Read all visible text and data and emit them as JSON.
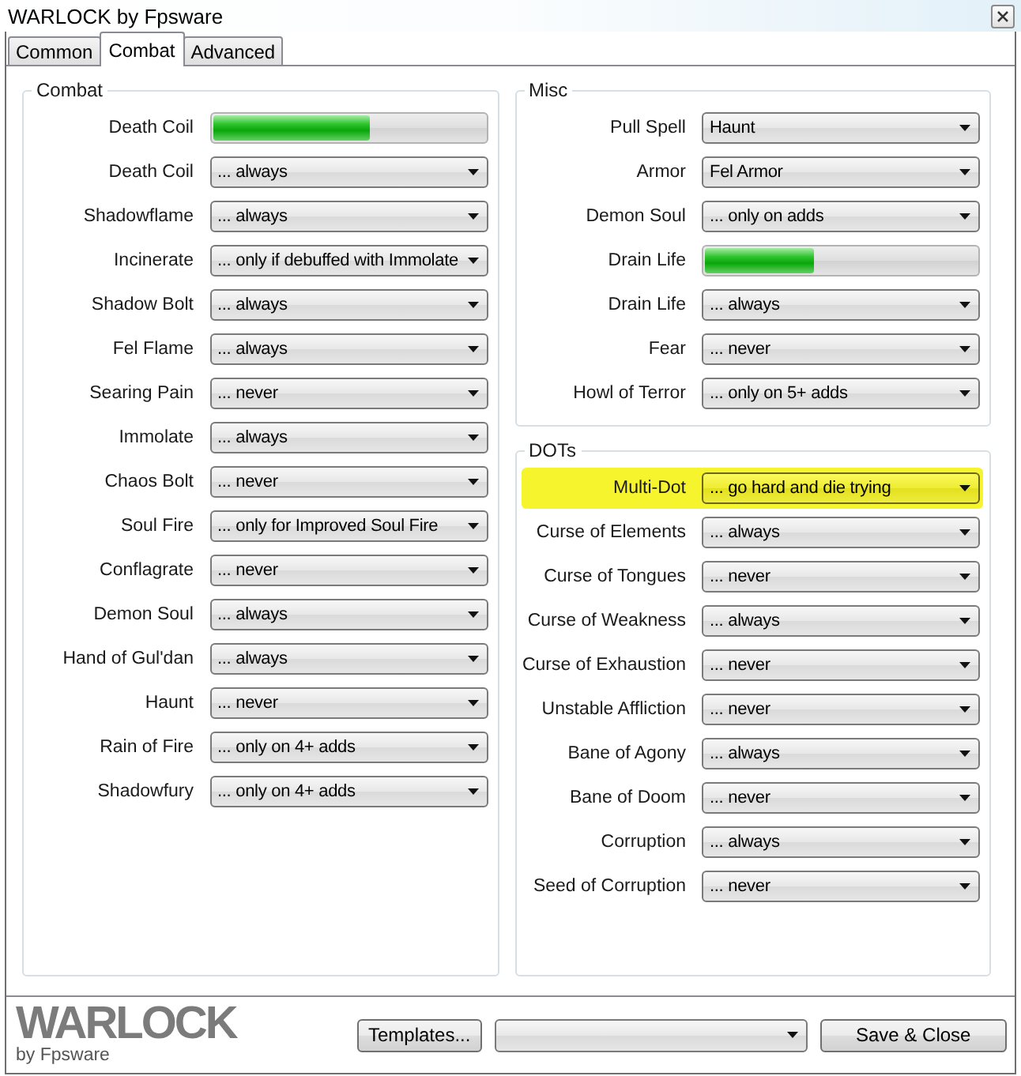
{
  "window": {
    "title": "WARLOCK by Fpsware"
  },
  "tabs": [
    {
      "label": "Common",
      "selected": false
    },
    {
      "label": "Combat",
      "selected": true
    },
    {
      "label": "Advanced",
      "selected": false
    }
  ],
  "columns": [
    {
      "groups": [
        {
          "title": "Combat",
          "rows": [
            {
              "label": "Death Coil",
              "kind": "slider",
              "level": 0.58,
              "highlighted": false
            },
            {
              "label": "Death Coil",
              "kind": "dropdown",
              "value": "... always",
              "highlighted": false
            },
            {
              "label": "Shadowflame",
              "kind": "dropdown",
              "value": "... always",
              "highlighted": false
            },
            {
              "label": "Incinerate",
              "kind": "dropdown",
              "value": "... only if debuffed with Immolate",
              "highlighted": false
            },
            {
              "label": "Shadow Bolt",
              "kind": "dropdown",
              "value": "... always",
              "highlighted": false
            },
            {
              "label": "Fel Flame",
              "kind": "dropdown",
              "value": "... always",
              "highlighted": false
            },
            {
              "label": "Searing Pain",
              "kind": "dropdown",
              "value": "... never",
              "highlighted": false
            },
            {
              "label": "Immolate",
              "kind": "dropdown",
              "value": "... always",
              "highlighted": false
            },
            {
              "label": "Chaos Bolt",
              "kind": "dropdown",
              "value": "... never",
              "highlighted": false
            },
            {
              "label": "Soul Fire",
              "kind": "dropdown",
              "value": "... only for Improved Soul Fire",
              "highlighted": false
            },
            {
              "label": "Conflagrate",
              "kind": "dropdown",
              "value": "... never",
              "highlighted": false
            },
            {
              "label": "Demon Soul",
              "kind": "dropdown",
              "value": "... always",
              "highlighted": false
            },
            {
              "label": "Hand of Gul'dan",
              "kind": "dropdown",
              "value": "... always",
              "highlighted": false
            },
            {
              "label": "Haunt",
              "kind": "dropdown",
              "value": "... never",
              "highlighted": false
            },
            {
              "label": "Rain of Fire",
              "kind": "dropdown",
              "value": "... only on 4+ adds",
              "highlighted": false
            },
            {
              "label": "Shadowfury",
              "kind": "dropdown",
              "value": "... only on 4+ adds",
              "highlighted": false
            }
          ]
        }
      ]
    },
    {
      "groups": [
        {
          "title": "Misc",
          "rows": [
            {
              "label": "Pull Spell",
              "kind": "dropdown",
              "value": "Haunt",
              "highlighted": false
            },
            {
              "label": "Armor",
              "kind": "dropdown",
              "value": "Fel Armor",
              "highlighted": false
            },
            {
              "label": "Demon Soul",
              "kind": "dropdown",
              "value": "... only on adds",
              "highlighted": false
            },
            {
              "label": "Drain Life",
              "kind": "slider",
              "level": 0.4,
              "highlighted": false
            },
            {
              "label": "Drain Life",
              "kind": "dropdown",
              "value": "... always",
              "highlighted": false
            },
            {
              "label": "Fear",
              "kind": "dropdown",
              "value": "... never",
              "highlighted": false
            },
            {
              "label": "Howl of Terror",
              "kind": "dropdown",
              "value": "... only on 5+ adds",
              "highlighted": false
            }
          ]
        },
        {
          "title": "DOTs",
          "rows": [
            {
              "label": "Multi-Dot",
              "kind": "dropdown",
              "value": "... go hard and die trying",
              "highlighted": true
            },
            {
              "label": "Curse of Elements",
              "kind": "dropdown",
              "value": "... always",
              "highlighted": false
            },
            {
              "label": "Curse of Tongues",
              "kind": "dropdown",
              "value": "... never",
              "highlighted": false
            },
            {
              "label": "Curse of Weakness",
              "kind": "dropdown",
              "value": "... always",
              "highlighted": false
            },
            {
              "label": "Curse of Exhaustion",
              "kind": "dropdown",
              "value": "... never",
              "highlighted": false
            },
            {
              "label": "Unstable Affliction",
              "kind": "dropdown",
              "value": "... never",
              "highlighted": false
            },
            {
              "label": "Bane of Agony",
              "kind": "dropdown",
              "value": "... always",
              "highlighted": false
            },
            {
              "label": "Bane of Doom",
              "kind": "dropdown",
              "value": "... never",
              "highlighted": false
            },
            {
              "label": "Corruption",
              "kind": "dropdown",
              "value": "... always",
              "highlighted": false
            },
            {
              "label": "Seed of Corruption",
              "kind": "dropdown",
              "value": "... never",
              "highlighted": false
            }
          ]
        }
      ]
    }
  ],
  "footer": {
    "logo": "WARLOCK",
    "logo_caption": "by Fpsware",
    "controls": [
      {
        "kind": "button",
        "label": "Templates..."
      },
      {
        "kind": "dropdown"
      },
      {
        "kind": "button",
        "label": "Save & Close"
      }
    ]
  }
}
